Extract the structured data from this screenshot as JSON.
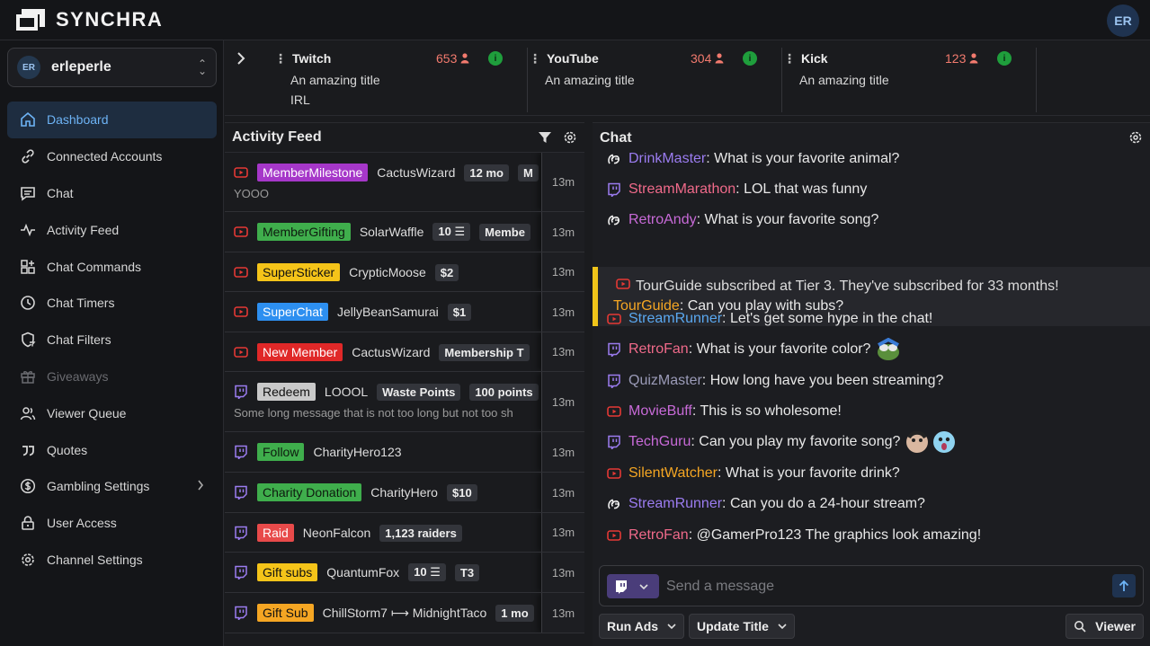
{
  "app": {
    "name": "SYNCHRA",
    "user_initials": "ER"
  },
  "account": {
    "initials": "ER",
    "name": "erleperle"
  },
  "nav": [
    {
      "label": "Dashboard",
      "icon": "home-icon",
      "active": true
    },
    {
      "label": "Connected Accounts",
      "icon": "link-icon"
    },
    {
      "label": "Chat",
      "icon": "chat-icon"
    },
    {
      "label": "Activity Feed",
      "icon": "activity-icon"
    },
    {
      "label": "Chat Commands",
      "icon": "commands-icon"
    },
    {
      "label": "Chat Timers",
      "icon": "clock-icon"
    },
    {
      "label": "Chat Filters",
      "icon": "filter-shield-icon"
    },
    {
      "label": "Giveaways",
      "icon": "gift-icon",
      "disabled": true
    },
    {
      "label": "Viewer Queue",
      "icon": "users-icon"
    },
    {
      "label": "Quotes",
      "icon": "quote-icon"
    },
    {
      "label": "Gambling Settings",
      "icon": "dollar-icon",
      "has_submenu": true
    },
    {
      "label": "User Access",
      "icon": "lock-icon"
    },
    {
      "label": "Channel Settings",
      "icon": "gear-icon"
    }
  ],
  "platforms": [
    {
      "name": "Twitch",
      "viewers": "653",
      "title": "An amazing title",
      "category": "IRL"
    },
    {
      "name": "YouTube",
      "viewers": "304",
      "title": "An amazing title",
      "category": ""
    },
    {
      "name": "Kick",
      "viewers": "123",
      "title": "An amazing title",
      "category": ""
    }
  ],
  "feed": {
    "title": "Activity Feed",
    "rows": [
      {
        "platform": "youtube",
        "tag": "MemberMilestone",
        "tag_color": "#a637c9",
        "tag_text_color": "#ffffff",
        "user": "CactusWizard",
        "chips": [
          "12 mo",
          "M"
        ],
        "sub": "YOOO",
        "time": "13m"
      },
      {
        "platform": "youtube",
        "tag": "MemberGifting",
        "tag_color": "#3fae4c",
        "tag_text_color": "#0e1a0f",
        "user": "SolarWaffle",
        "chips": [
          "10 ☰",
          "Membe"
        ],
        "sub": "",
        "time": "13m"
      },
      {
        "platform": "youtube",
        "tag": "SuperSticker",
        "tag_color": "#f5c419",
        "tag_text_color": "#111111",
        "user": "CrypticMoose",
        "chips": [
          "$2"
        ],
        "sub": "",
        "time": "13m"
      },
      {
        "platform": "youtube",
        "tag": "SuperChat",
        "tag_color": "#2d8ff0",
        "tag_text_color": "#ffffff",
        "user": "JellyBeanSamurai",
        "chips": [
          "$1"
        ],
        "sub": "",
        "time": "13m"
      },
      {
        "platform": "youtube",
        "tag": "New Member",
        "tag_color": "#e02828",
        "tag_text_color": "#ffffff",
        "user": "CactusWizard",
        "chips": [
          "Membership T"
        ],
        "sub": "",
        "time": "13m"
      },
      {
        "platform": "twitch",
        "tag": "Redeem",
        "tag_color": "#c9c9c9",
        "tag_text_color": "#111111",
        "user": "LOOOL",
        "chips": [
          "Waste Points",
          "100 points"
        ],
        "sub": "Some long message that is not too long but not too sh",
        "time": "13m"
      },
      {
        "platform": "twitch",
        "tag": "Follow",
        "tag_color": "#3fae4c",
        "tag_text_color": "#0e1a0f",
        "user": "CharityHero123",
        "chips": [],
        "sub": "",
        "time": "13m"
      },
      {
        "platform": "twitch",
        "tag": "Charity Donation",
        "tag_color": "#3fae4c",
        "tag_text_color": "#0e1a0f",
        "user": "CharityHero",
        "chips": [
          "$10"
        ],
        "sub": "",
        "time": "13m"
      },
      {
        "platform": "twitch",
        "tag": "Raid",
        "tag_color": "#e84a4a",
        "tag_text_color": "#ffffff",
        "user": "NeonFalcon",
        "chips": [
          "1,123 raiders"
        ],
        "sub": "",
        "time": "13m"
      },
      {
        "platform": "twitch",
        "tag": "Gift subs",
        "tag_color": "#f5c419",
        "tag_text_color": "#111111",
        "user": "QuantumFox",
        "chips": [
          "10 ☰",
          "T3"
        ],
        "sub": "",
        "time": "13m"
      },
      {
        "platform": "twitch",
        "tag": "Gift Sub",
        "tag_color": "#f5a623",
        "tag_text_color": "#111111",
        "user": "ChillStorm7 ⟼ MidnightTaco",
        "chips": [
          "1 mo"
        ],
        "sub": "",
        "time": "13m"
      }
    ]
  },
  "chat": {
    "title": "Chat",
    "messages": [
      {
        "platform": "kick",
        "user": "DrinkMaster",
        "user_color": "#9b7cf0",
        "text": ": What is your favorite animal?"
      },
      {
        "platform": "twitch",
        "user": "StreamMarathon",
        "user_color": "#f06a8a",
        "text": ": LOL that was funny"
      },
      {
        "platform": "kick",
        "user": "RetroAndy",
        "user_color": "#c86ad8",
        "text": ": What is your favorite song?"
      },
      {
        "platform": "youtube",
        "user": "StreamRunner",
        "user_color": "#5aa8f0",
        "text": ": Let's get some hype in the chat!"
      },
      {
        "platform": "twitch",
        "user": "RetroFan",
        "user_color": "#f06a8a",
        "text": ": What is your favorite color?",
        "emote": "pepe-emote"
      },
      {
        "platform": "twitch",
        "user": "QuizMaster",
        "user_color": "#9b9bb8",
        "text": ": How long have you been streaming?"
      },
      {
        "platform": "youtube",
        "user": "MovieBuff",
        "user_color": "#c86ad8",
        "text": ": This is so wholesome!"
      },
      {
        "platform": "twitch",
        "user": "TechGuru",
        "user_color": "#c86ad8",
        "text": ": Can you play my favorite song?",
        "emote": "face-emote"
      },
      {
        "platform": "youtube",
        "user": "SilentWatcher",
        "user_color": "#f5a623",
        "text": ": What is your favorite drink?"
      },
      {
        "platform": "kick",
        "user": "StreamRunner",
        "user_color": "#9b7cf0",
        "text": ": Can you do a 24-hour stream?"
      },
      {
        "platform": "youtube",
        "user": "RetroFan",
        "user_color": "#f06a8a",
        "text": ": @GamerPro123 The graphics look amazing!"
      }
    ],
    "sub_event": {
      "text": "TourGuide subscribed at Tier 3. They've subscribed for 33 months!",
      "user": "TourGuide",
      "user_color": "#f5a623",
      "message": ": Can you play with subs?"
    },
    "input_placeholder": "Send a message",
    "buttons": {
      "run_ads": "Run Ads",
      "update_title": "Update Title",
      "viewer": "Viewer"
    }
  },
  "colors": {
    "accent": "#6db3f5",
    "twitch": "#9b7cf0",
    "youtube": "#e53935",
    "live": "#1f9e3c"
  }
}
